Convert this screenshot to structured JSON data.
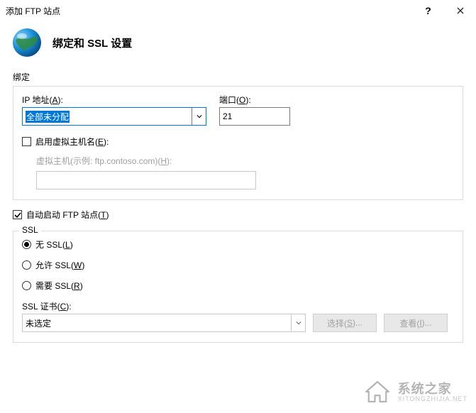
{
  "titlebar": {
    "title": "添加 FTP 站点"
  },
  "header": {
    "page_title": "绑定和 SSL 设置"
  },
  "binding": {
    "group_label": "绑定",
    "ip_label_pre": "IP 地址(",
    "ip_label_key": "A",
    "ip_label_post": "):",
    "ip_value": "全部未分配",
    "port_label_pre": "端口(",
    "port_label_key": "O",
    "port_label_post": "):",
    "port_value": "21",
    "vh_enable_pre": "启用虚拟主机名(",
    "vh_enable_key": "E",
    "vh_enable_post": "):",
    "vh_hint_pre": "虚拟主机(示例: ftp.contoso.com)(",
    "vh_hint_key": "H",
    "vh_hint_post": "):",
    "vh_value": ""
  },
  "autostart": {
    "label_pre": "自动启动 FTP 站点(",
    "label_key": "T",
    "label_post": ")"
  },
  "ssl": {
    "group_label": "SSL",
    "no_ssl_pre": "无 SSL(",
    "no_ssl_key": "L",
    "no_ssl_post": ")",
    "allow_ssl_pre": "允许 SSL(",
    "allow_ssl_key": "W",
    "allow_ssl_post": ")",
    "require_ssl_pre": "需要 SSL(",
    "require_ssl_key": "R",
    "require_ssl_post": ")",
    "cert_label_pre": "SSL 证书(",
    "cert_label_key": "C",
    "cert_label_post": "):",
    "cert_value": "未选定",
    "select_btn_pre": "选择(",
    "select_btn_key": "S",
    "select_btn_post": ")...",
    "view_btn_pre": "查看(",
    "view_btn_key": "I",
    "view_btn_post": ")..."
  },
  "watermark": {
    "name": "系统之家",
    "sub": "XITONGZHIJIA.NET"
  }
}
